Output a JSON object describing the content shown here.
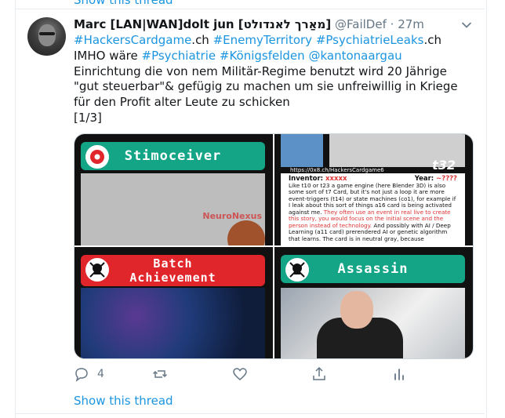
{
  "top_link": "Show this thread",
  "tweet": {
    "author_name": "Marc [LAN|WAN]dolt jun [מאַרך לאנדולט]",
    "handle": "@FailDef",
    "separator": "·",
    "time": "27m",
    "lines": [
      [
        {
          "text": "#HackersCardgame",
          "link": true
        },
        {
          "text": ".ch",
          "link": false
        },
        {
          "text": " #EnemyTerritory",
          "link": true
        },
        {
          "text": " #PsychiatrieLeaks",
          "link": true
        },
        {
          "text": ".ch",
          "link": false
        }
      ],
      [
        {
          "text": "IMHO wäre ",
          "link": false
        },
        {
          "text": "#Psychiatrie",
          "link": true
        },
        {
          "text": " #Königsfelden",
          "link": true
        },
        {
          "text": " @kantonaargau",
          "link": true
        }
      ],
      [
        {
          "text": "Einrichtung die von nem Militär-Regime benutzt wird 20 Jährige",
          "link": false
        }
      ],
      [
        {
          "text": "\"gut steuerbar\"& gefügig zu machen um sie unfreiwillig in Kriege",
          "link": false
        }
      ],
      [
        {
          "text": "für den Profit alter Leute zu schicken",
          "link": false
        }
      ],
      [
        {
          "text": "[1/3]",
          "link": false
        }
      ]
    ]
  },
  "cards": {
    "c1": {
      "title": "Stimoceiver",
      "brand": "NeuroNexus",
      "icon": "gear-icon"
    },
    "c2": {
      "tag": "t32",
      "url": "https://0x8.ch/HackersCardgame6",
      "inventor_label": "Inventor:",
      "inventor_value": "xxxxx",
      "year_label": "Year:",
      "year_value": "~????",
      "text_black_1": "Like t10 or t23 a game engine (here Blender 3D) is also some sort of t7 Card, but it's not just a loop it are more event-triggers (t14) or state machines (co1), for example if I leak about this sort of things a16 card is being activated against me.",
      "text_red": "They often use an event in real live to create this story, you would focus on the initial scene and the person instead of technology.",
      "text_black_2": "And possibly with AI / Deep Learning (a11 card) prerendered AI or genetic algorithm that learns. The card is in neutral gray, because"
    },
    "c3": {
      "title_line1": "Batch",
      "title_line2": "Achievement",
      "icon": "skull-icon"
    },
    "c4": {
      "title": "Assassin",
      "icon": "skull-icon"
    }
  },
  "actions": {
    "reply_count": "4",
    "retweet_count": "",
    "like_count": ""
  },
  "show_thread": "Show this thread",
  "colors": {
    "link": "#1b95e0",
    "meta": "#657786",
    "divider": "#e6ecf0",
    "green": "#13a586",
    "red": "#e0262a"
  }
}
